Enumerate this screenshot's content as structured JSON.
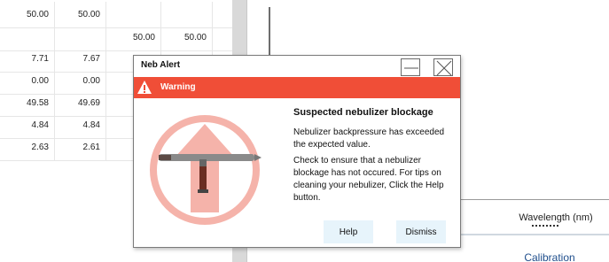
{
  "table": {
    "rows": [
      [
        "50.00",
        "50.00",
        "",
        ""
      ],
      [
        "",
        "",
        "50.00",
        "50.00"
      ],
      [
        "7.71",
        "7.67",
        "",
        ""
      ],
      [
        "0.00",
        "0.00",
        "",
        ""
      ],
      [
        "49.58",
        "49.69",
        "",
        ""
      ],
      [
        "4.84",
        "4.84",
        "",
        ""
      ],
      [
        "2.63",
        "2.61",
        "",
        ""
      ]
    ]
  },
  "panel": {
    "axis_label": "Wavelength (nm)",
    "tab_label": "Calibration"
  },
  "dialog": {
    "title": "Neb Alert",
    "warning_label": "Warning",
    "heading": "Suspected nebulizer blockage",
    "message1": "Nebulizer backpressure has exceeded the expected value.",
    "message2": "Check to ensure that a nebulizer blockage has not occured. For tips on cleaning your nebulizer, Click the Help button.",
    "help_label": "Help",
    "dismiss_label": "Dismiss"
  },
  "colors": {
    "warning_bar": "#f04e37",
    "illustration_ring": "#f5b3aa",
    "button_bg": "#e7f4fb",
    "link_text": "#1f4e8c"
  },
  "icons": {
    "warning": "warning-triangle-icon",
    "minimize": "minimize-icon",
    "close": "close-icon",
    "illustration": "nebulizer-blockage-icon"
  }
}
